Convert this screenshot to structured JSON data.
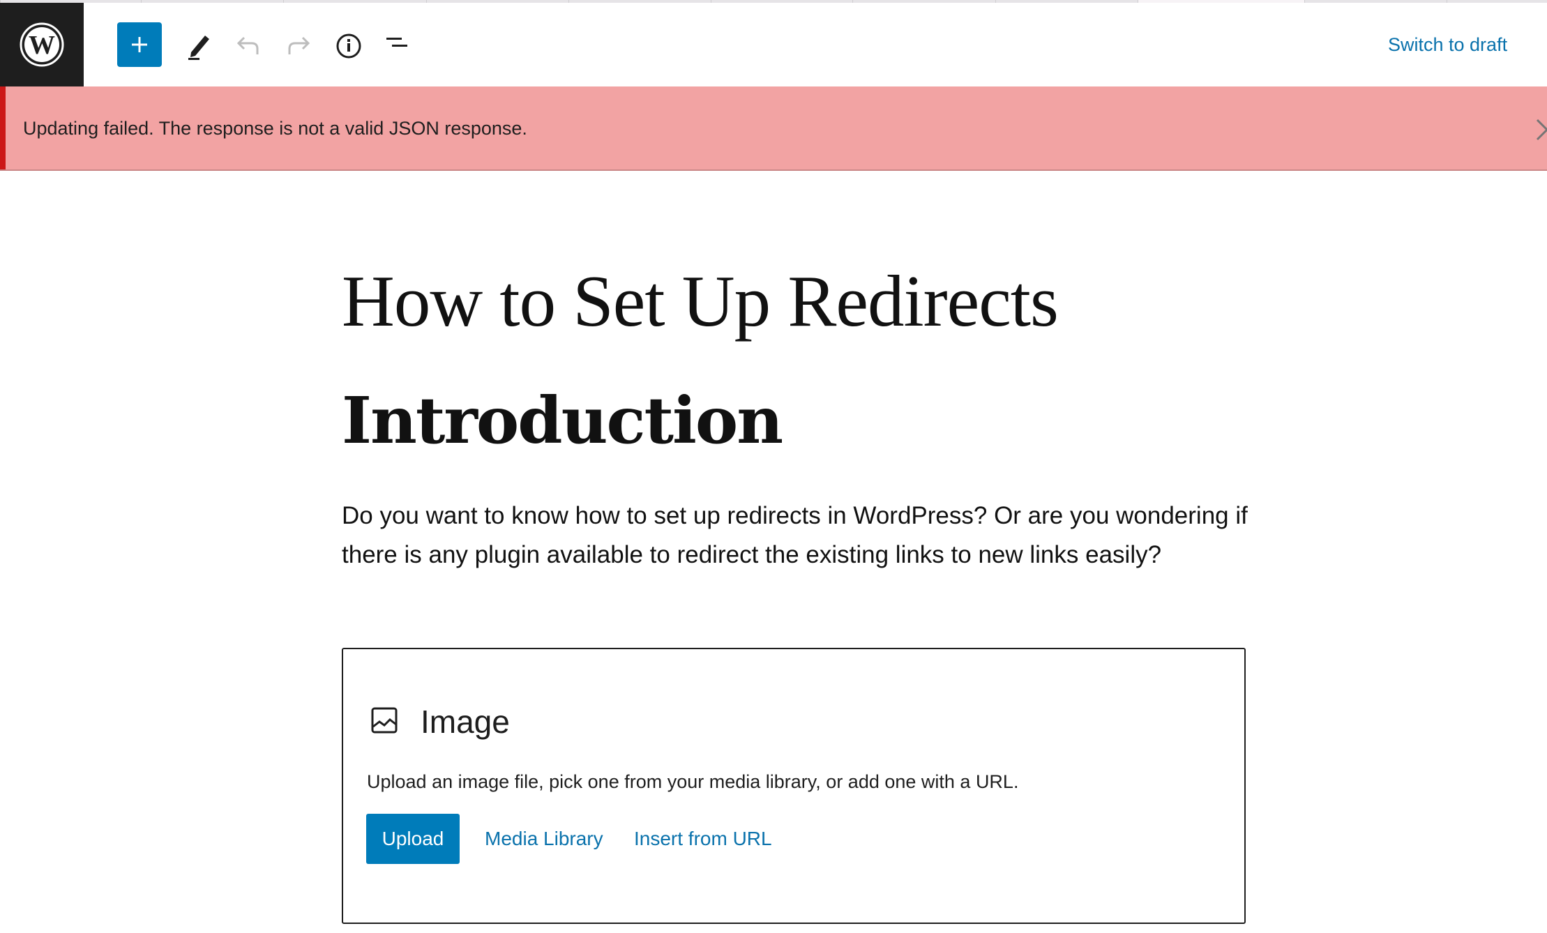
{
  "browser": {
    "tab_count": 11,
    "active_tab_index": 8
  },
  "toolbar": {
    "logo": "wordpress-logo",
    "inserter_icon": "plus-icon",
    "tools_icon": "pencil-icon",
    "undo_icon": "undo-icon",
    "redo_icon": "redo-icon",
    "info_icon": "info-icon",
    "list_view_icon": "list-view-icon",
    "switch_to_draft_label": "Switch to draft"
  },
  "notice": {
    "type": "error",
    "message": "Updating failed. The response is not a valid JSON response.",
    "close_icon": "close-icon",
    "accent_color": "#cc1818",
    "background_color": "#f2a3a3"
  },
  "post": {
    "title": "How to Set Up Redirects",
    "heading": "Introduction",
    "paragraph": "Do you want to know how to set up redirects in WordPress?  Or are you wondering if there is any plugin available to redirect the existing links to new links easily?"
  },
  "image_block": {
    "icon": "image-icon",
    "label": "Image",
    "instructions": "Upload an image file, pick one from your media library, or add one with a URL.",
    "upload_label": "Upload",
    "media_library_label": "Media Library",
    "insert_from_url_label": "Insert from URL"
  },
  "colors": {
    "primary": "#007cba",
    "link": "#0a72ac",
    "logo_background": "#1e1e1e"
  }
}
